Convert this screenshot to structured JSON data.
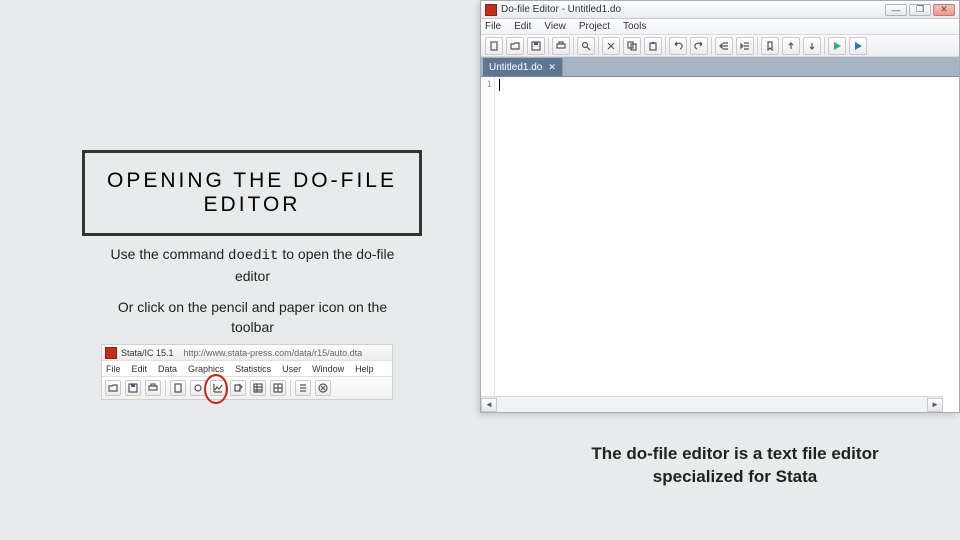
{
  "slide": {
    "title": "OPENING THE DO-FILE EDITOR",
    "instruction1_pre": "Use the command ",
    "instruction1_code": "doedit",
    "instruction1_post": " to open the do-file editor",
    "instruction2": "Or click on the pencil and paper icon on the toolbar",
    "caption": "The do-file editor is a text file editor specialized for Stata"
  },
  "stata_main": {
    "app_title": "Stata/IC 15.1",
    "url_text": "http://www.stata-press.com/data/r15/auto.dta",
    "menus": [
      "File",
      "Edit",
      "Data",
      "Graphics",
      "Statistics",
      "User",
      "Window",
      "Help"
    ]
  },
  "dofile": {
    "window_title": "Do-file Editor - Untitled1.do",
    "menus": [
      "File",
      "Edit",
      "View",
      "Project",
      "Tools"
    ],
    "tab_label": "Untitled1.do",
    "tab_close": "✕",
    "line_number": "1",
    "win_min": "—",
    "win_max": "❐",
    "win_close": "✕",
    "scroll_left": "◄",
    "scroll_right": "►"
  }
}
